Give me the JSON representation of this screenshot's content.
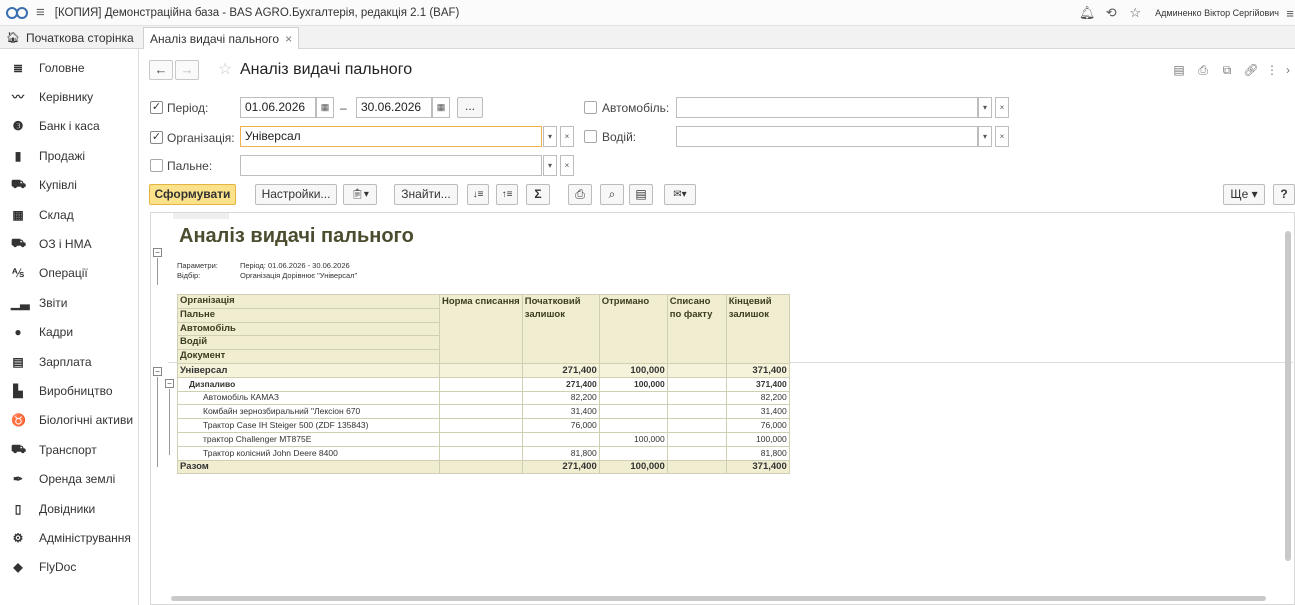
{
  "app": {
    "title": "[КОПИЯ] Демонстраційна база - BAS AGRO.Бухгалтерія, редакція 2.1  (BAF)",
    "username": "Админенко Віктор Сергійович"
  },
  "tabs": {
    "home": "Початкова сторінка",
    "active": "Аналіз видачі пального"
  },
  "sidebar": {
    "items": [
      {
        "label": "Головне",
        "icon": "menu-icon"
      },
      {
        "label": "Керівнику",
        "icon": "trend-icon"
      },
      {
        "label": "Банк і каса",
        "icon": "bank-icon"
      },
      {
        "label": "Продажі",
        "icon": "bag-icon"
      },
      {
        "label": "Купівлі",
        "icon": "cart-icon"
      },
      {
        "label": "Склад",
        "icon": "warehouse-icon"
      },
      {
        "label": "ОЗ і НМА",
        "icon": "truck-icon"
      },
      {
        "label": "Операції",
        "icon": "operations-icon"
      },
      {
        "label": "Звіти",
        "icon": "bar-chart-icon"
      },
      {
        "label": "Кадри",
        "icon": "person-icon"
      },
      {
        "label": "Зарплата",
        "icon": "calculator-icon"
      },
      {
        "label": "Виробництво",
        "icon": "factory-icon"
      },
      {
        "label": "Біологічні активи",
        "icon": "animal-icon"
      },
      {
        "label": "Транспорт",
        "icon": "tractor-icon"
      },
      {
        "label": "Оренда землі",
        "icon": "feather-icon"
      },
      {
        "label": "Довідники",
        "icon": "books-icon"
      },
      {
        "label": "Адміністрування",
        "icon": "gear-icon"
      },
      {
        "label": "FlyDoc",
        "icon": "flydoc-icon"
      }
    ]
  },
  "form": {
    "title": "Аналіз видачі пального",
    "period_label": "Період:",
    "period_from": "01.06.2026",
    "period_to": "30.06.2026",
    "period_dash": "–",
    "period_more": "...",
    "org_label": "Організація:",
    "org_value": "Універсал",
    "fuel_label": "Пальне:",
    "fuel_value": "",
    "car_label": "Автомобіль:",
    "car_value": "",
    "driver_label": "Водій:",
    "driver_value": "",
    "period_checked": true,
    "org_checked": true,
    "fuel_checked": false,
    "car_checked": false,
    "driver_checked": false
  },
  "toolbar": {
    "generate": "Сформувати",
    "settings": "Настройки...",
    "find": "Знайти...",
    "sum": "Σ",
    "more": "Ще",
    "help": "?"
  },
  "report": {
    "title": "Аналіз видачі пального",
    "params_label": "Параметри:",
    "params_value": "Період: 01.06.2026 - 30.06.2026",
    "filter_label": "Відбір:",
    "filter_value": "Організація Дорівнює \"Універсал\"",
    "headers": {
      "group": [
        "Організація",
        "Пальне",
        "Автомобіль",
        "Водій",
        "Документ"
      ],
      "norm": "Норма списання",
      "opening": "Початковий залишок",
      "received": "Отримано",
      "written_off": "Списано по факту",
      "closing": "Кінцевий залишок"
    },
    "org_row": {
      "name": "Універсал",
      "opening": "271,400",
      "received": "100,000",
      "written_off": "",
      "closing": "371,400"
    },
    "fuel_row": {
      "name": "Дизпаливо",
      "opening": "271,400",
      "received": "100,000",
      "written_off": "",
      "closing": "371,400"
    },
    "rows": [
      {
        "name": "Автомобіль КАМАЗ",
        "opening": "82,200",
        "received": "",
        "closing": "82,200"
      },
      {
        "name": "Комбайн зернозбиральний \"Лексіон 670",
        "opening": "31,400",
        "received": "",
        "closing": "31,400"
      },
      {
        "name": "Трактор Case IH Steiger 500 (ZDF 135843)",
        "opening": "76,000",
        "received": "",
        "closing": "76,000"
      },
      {
        "name": "трактор Challenger MT875E",
        "opening": "",
        "received": "100,000",
        "closing": "100,000"
      },
      {
        "name": "Трактор колісний John Deere 8400",
        "opening": "81,800",
        "received": "",
        "closing": "81,800"
      }
    ],
    "total": {
      "name": "Разом",
      "opening": "271,400",
      "received": "100,000",
      "written_off": "",
      "closing": "371,400"
    }
  }
}
